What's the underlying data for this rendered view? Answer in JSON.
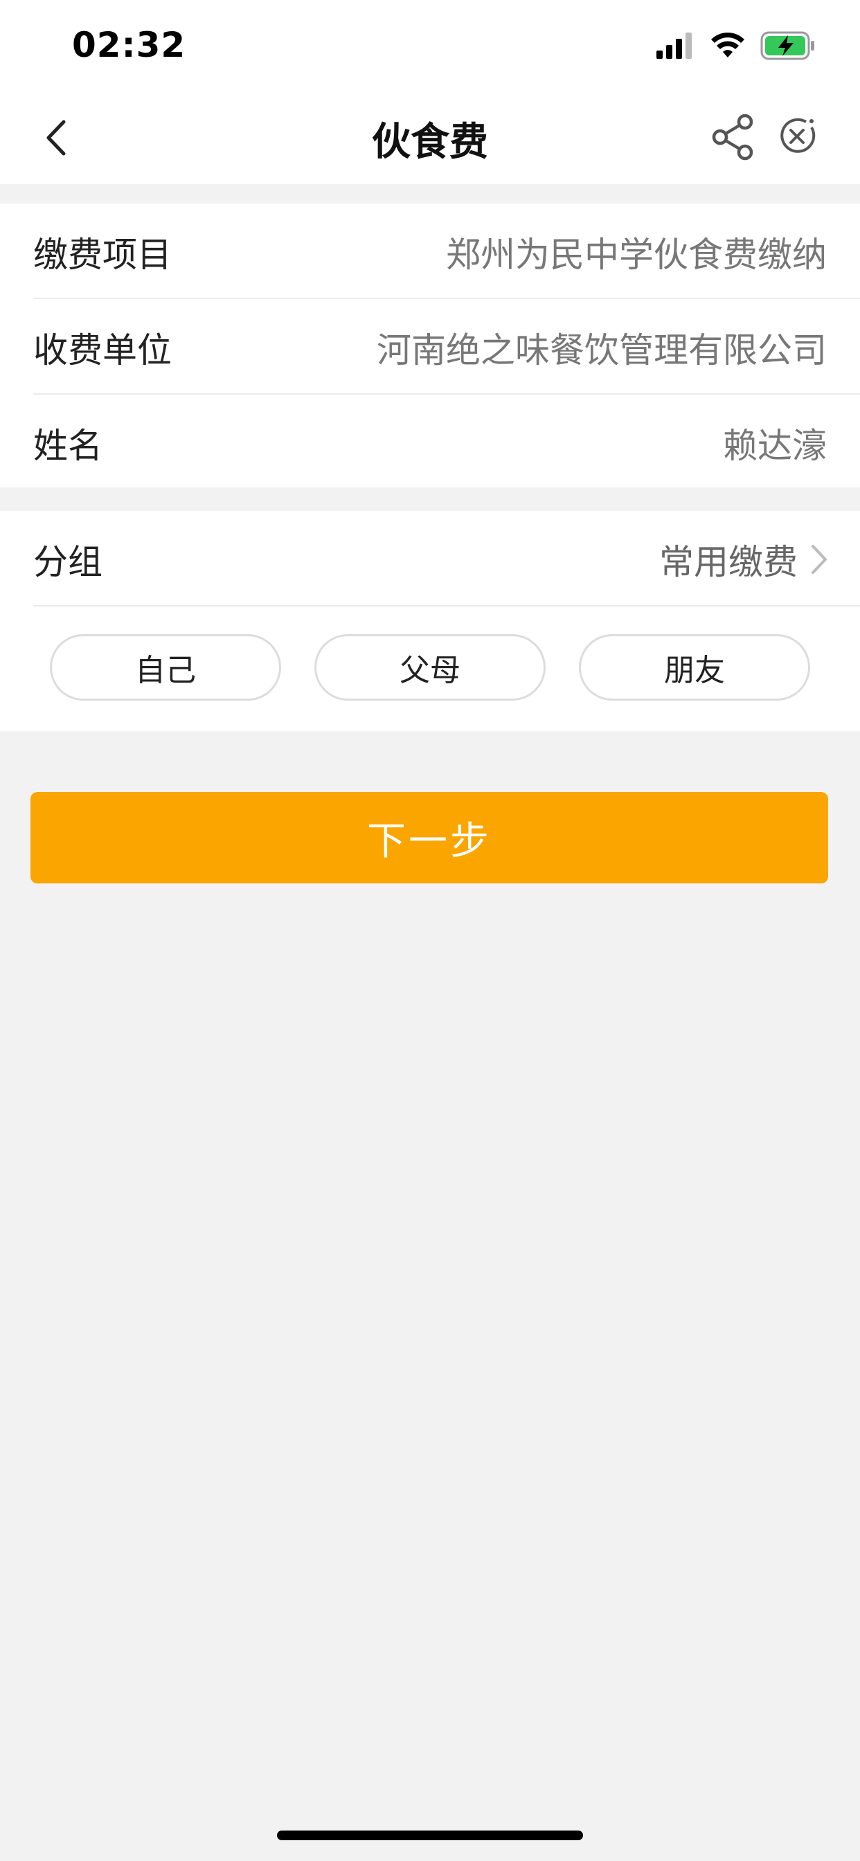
{
  "status_bar": {
    "time": "02:32"
  },
  "nav": {
    "title": "伙食费"
  },
  "info": [
    {
      "label": "缴费项目",
      "value": "郑州为民中学伙食费缴纳"
    },
    {
      "label": "收费单位",
      "value": "河南绝之味餐饮管理有限公司"
    },
    {
      "label": "姓名",
      "value": "赖达濠"
    }
  ],
  "group": {
    "label": "分组",
    "value": "常用缴费",
    "chips": [
      "自己",
      "父母",
      "朋友"
    ]
  },
  "next_button": {
    "label": "下一步"
  },
  "colors": {
    "accent": "#faa500",
    "background": "#f2f2f2",
    "battery": "#34c759"
  },
  "icons": [
    "signal-icon",
    "wifi-icon",
    "battery-charging-icon",
    "back-icon",
    "share-icon",
    "close-icon",
    "chevron-right-icon"
  ]
}
